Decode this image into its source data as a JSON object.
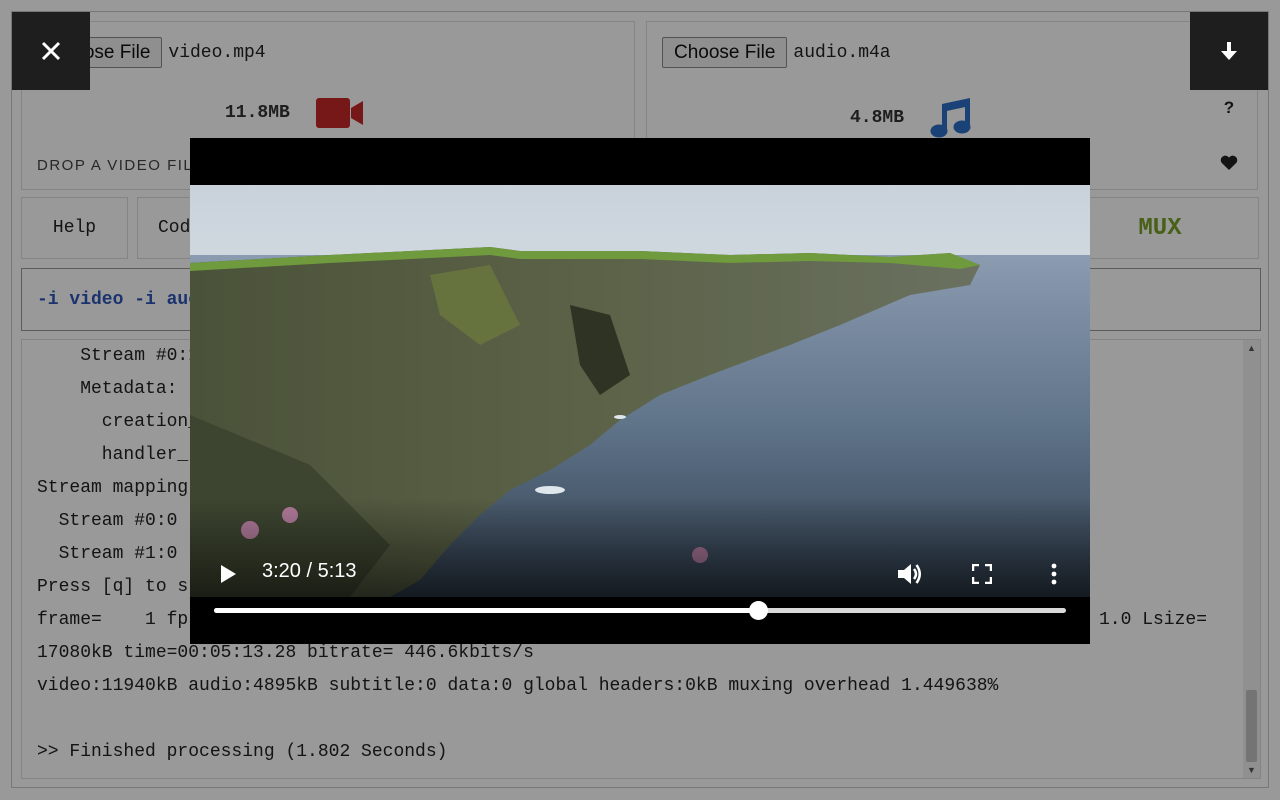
{
  "video_input": {
    "button_label": "Choose File",
    "file_name": "video.mp4",
    "size": "11.8MB",
    "drop_hint": "DROP A VIDEO FILE",
    "icon": "video-camera-icon",
    "icon_color": "#c62828"
  },
  "audio_input": {
    "button_label": "Choose File",
    "file_name": "audio.m4a",
    "size": "4.8MB",
    "icon": "music-note-icon",
    "icon_color": "#2d6fc7"
  },
  "side_buttons": {
    "download_icon": "arrow-down-icon",
    "help_symbol": "?",
    "favorite_icon": "heart-icon"
  },
  "tabs": {
    "help": "Help",
    "codecs": "Cod",
    "mux": "MUX",
    "mux_color": "#7aa12a"
  },
  "command": {
    "text": "-i video -i auc"
  },
  "log": {
    "lines": [
      "    Stream #0:1",
      "    Metadata:",
      "      creation_",
      "      handler_",
      "Stream mapping",
      "  Stream #0:0 ",
      "  Stream #1:0 ",
      "Press [q] to st",
      "frame=    1 fps",
      "17080kB time=00:05:13.28 bitrate= 446.6kbits/s",
      "video:11940kB audio:4895kB subtitle:0 data:0 global headers:0kB muxing overhead 1.449638%",
      "",
      ">> Finished processing (1.802 Seconds)"
    ],
    "trailing_fragment": "1.0 Lsize="
  },
  "overlay": {
    "close_icon": "close-icon"
  },
  "player": {
    "current_time": "3:20",
    "duration": "5:13",
    "time_display": "3:20 / 5:13",
    "progress_fraction": 0.639
  }
}
